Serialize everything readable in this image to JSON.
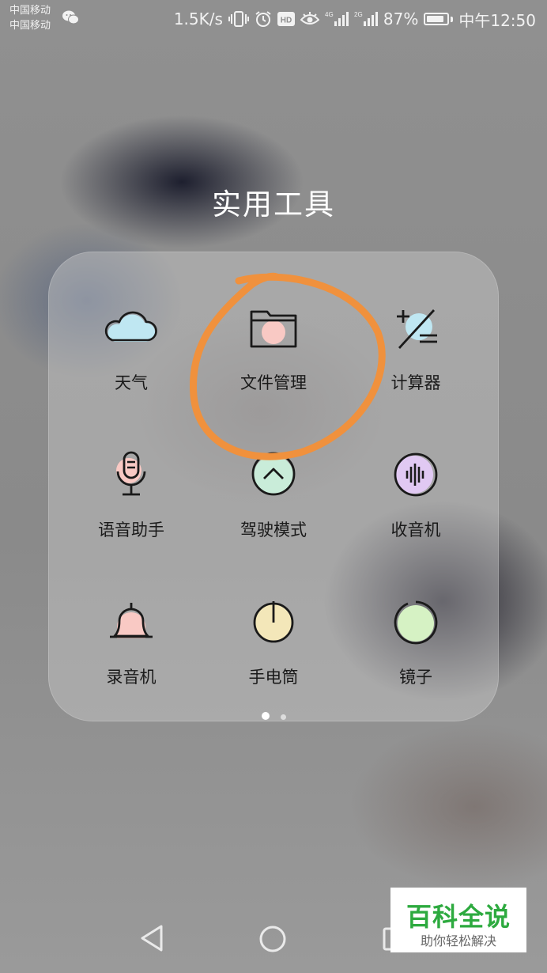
{
  "status_bar": {
    "carrier_1": "中国移动",
    "carrier_2": "中国移动",
    "net_speed": "1.5K/s",
    "hd": "HD",
    "net_4g": "4G",
    "net_2g": "2G",
    "battery_percent": "87%",
    "battery_level": 0.87,
    "time": "中午12:50",
    "icons": [
      "wechat-icon",
      "vibrate-icon",
      "alarm-icon",
      "hd-icon",
      "eye-comfort-icon",
      "signal-4g-icon",
      "signal-2g-icon",
      "battery-icon"
    ]
  },
  "folder": {
    "title": "实用工具",
    "page_count": 2,
    "current_page": 1,
    "apps": [
      {
        "label": "天气",
        "icon": "weather-cloud-icon",
        "accent": "#bfe7f2"
      },
      {
        "label": "文件管理",
        "icon": "folder-icon",
        "accent": "#f9c9c4"
      },
      {
        "label": "计算器",
        "icon": "calculator-icon",
        "accent": "#bfe7f2"
      },
      {
        "label": "语音助手",
        "icon": "microphone-icon",
        "accent": "#f9c9c4"
      },
      {
        "label": "驾驶模式",
        "icon": "driving-chevron-icon",
        "accent": "#c9ecd9"
      },
      {
        "label": "收音机",
        "icon": "radio-waveform-icon",
        "accent": "#e1c9f3"
      },
      {
        "label": "录音机",
        "icon": "bell-icon",
        "accent": "#f9c9c4"
      },
      {
        "label": "手电筒",
        "icon": "flashlight-power-icon",
        "accent": "#f3e7b9"
      },
      {
        "label": "镜子",
        "icon": "mirror-circle-icon",
        "accent": "#d6f2c4"
      }
    ]
  },
  "annotation": {
    "color": "#f0913d",
    "target": "文件管理"
  },
  "nav_bar": {
    "icons": [
      "back-triangle-icon",
      "home-circle-icon",
      "recents-square-icon"
    ]
  },
  "watermark": {
    "title": "百科全说",
    "subtitle": "助你轻松解决",
    "color": "#2daa3f"
  }
}
